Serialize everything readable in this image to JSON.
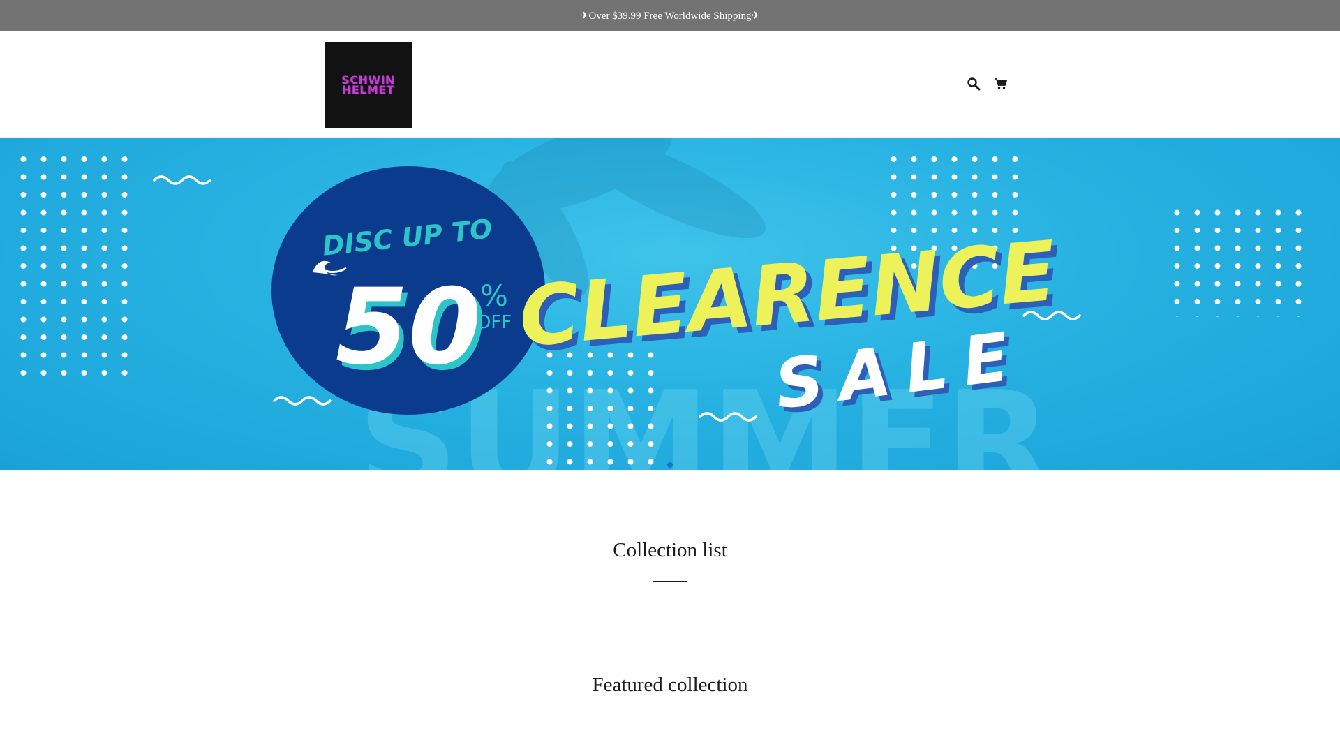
{
  "announcement": {
    "text": "✈Over $39.99 Free Worldwide Shipping✈"
  },
  "header": {
    "logo_line1": "SCHWIN",
    "logo_line2": "HELMET",
    "icons": [
      "search-icon",
      "cart-icon"
    ]
  },
  "hero": {
    "disc_text": "DISC UP TO",
    "percent_number": "50",
    "percent_sign": "%",
    "off_text": "OFF",
    "clearence_text": "CLEARENCE",
    "sale_text": "SALE",
    "background_word": "SUMMER",
    "colors": {
      "water": "#27b2e2",
      "circle": "#0b3b8c",
      "yellow": "#eef25a",
      "teal": "#2bc4c9",
      "shadow": "#2d5fb8"
    }
  },
  "sections": {
    "collection_list_title": "Collection list",
    "featured_collection_title": "Featured collection"
  }
}
